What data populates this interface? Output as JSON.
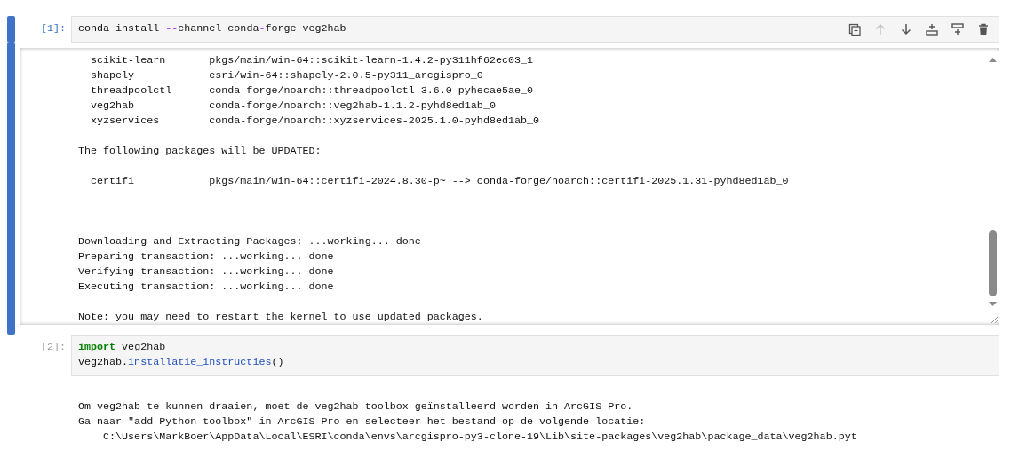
{
  "cells": [
    {
      "prompt": "[1]:",
      "active": true,
      "code": [
        [
          {
            "kind": "plain",
            "text": "conda install "
          },
          {
            "kind": "operator",
            "text": "--"
          },
          {
            "kind": "plain",
            "text": "channel conda"
          },
          {
            "kind": "operator",
            "text": "-"
          },
          {
            "kind": "plain",
            "text": "forge veg2hab"
          }
        ]
      ],
      "toolbar": [
        {
          "kind": "duplicate",
          "disabled": false
        },
        {
          "kind": "move-up",
          "disabled": true
        },
        {
          "kind": "move-down",
          "disabled": false
        },
        {
          "kind": "insert-above",
          "disabled": false
        },
        {
          "kind": "insert-below",
          "disabled": false
        },
        {
          "kind": "delete",
          "disabled": false
        }
      ],
      "output": {
        "scrolled": true,
        "blocks": [
          [
            "  scikit-learn       pkgs/main/win-64::scikit-learn-1.4.2-py311hf62ec03_1",
            "  shapely            esri/win-64::shapely-2.0.5-py311_arcgispro_0",
            "  threadpoolctl      conda-forge/noarch::threadpoolctl-3.6.0-pyhecae5ae_0",
            "  veg2hab            conda-forge/noarch::veg2hab-1.1.2-pyhd8ed1ab_0",
            "  xyzservices        conda-forge/noarch::xyzservices-2025.1.0-pyhd8ed1ab_0"
          ],
          [
            "The following packages will be UPDATED:"
          ],
          [
            "  certifi            pkgs/main/win-64::certifi-2024.8.30-p~ --> conda-forge/noarch::certifi-2025.1.31-pyhd8ed1ab_0"
          ],
          [
            "Downloading and Extracting Packages: ...working... done",
            "Preparing transaction: ...working... done",
            "Verifying transaction: ...working... done",
            "Executing transaction: ...working... done"
          ],
          [
            "Note: you may need to restart the kernel to use updated packages."
          ]
        ]
      }
    },
    {
      "prompt": "[2]:",
      "active": false,
      "code": [
        [
          {
            "kind": "keyword",
            "text": "import"
          },
          {
            "kind": "plain",
            "text": " veg2hab"
          }
        ],
        [
          {
            "kind": "plain",
            "text": "veg2hab."
          },
          {
            "kind": "name",
            "text": "installatie_instructies"
          },
          {
            "kind": "plain",
            "text": "()"
          }
        ]
      ],
      "output": {
        "scrolled": false,
        "blocks": [
          [
            "Om veg2hab te kunnen draaien, moet de veg2hab toolbox geïnstalleerd worden in ArcGIS Pro.",
            "Ga naar \"add Python toolbox\" in ArcGIS Pro en selecteer het bestand op de volgende locatie:",
            "    C:\\Users\\MarkBoer\\AppData\\Local\\ESRI\\conda\\envs\\arcgispro-py3-clone-19\\Lib\\site-packages\\veg2hab\\package_data\\veg2hab.pyt"
          ]
        ]
      }
    }
  ]
}
